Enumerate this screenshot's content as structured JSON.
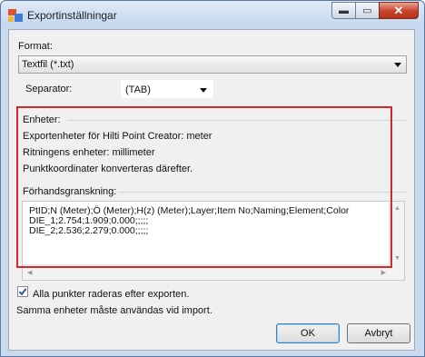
{
  "window": {
    "title": "Exportinställningar",
    "minimize_glyph": "▬",
    "maximize_glyph": "▭",
    "close_glyph": "✕"
  },
  "format": {
    "label": "Format:",
    "selected": "Textfil (*.txt)"
  },
  "separator": {
    "label": "Separator:",
    "selected": "(TAB)"
  },
  "units": {
    "heading": "Enheter:",
    "line1": "Exportenheter för Hilti Point Creator: meter",
    "line2": "Ritningens enheter: millimeter",
    "line3": "Punktkoordinater konverteras därefter."
  },
  "preview": {
    "heading": "Förhandsgranskning:",
    "lines": [
      "PtID;N (Meter);Ö (Meter);H(z) (Meter);Layer;Item No;Naming;Element;Color",
      "DIE_1;2.754;1.909;0.000;;;;;",
      "DIE_2;2.536;2.279;0.000;;;;;"
    ]
  },
  "checkbox": {
    "label": "Alla punkter raderas efter exporten.",
    "checked": true
  },
  "note": "Samma enheter måste användas vid import.",
  "buttons": {
    "ok": "OK",
    "cancel": "Avbryt"
  },
  "icons": {
    "app": "app-icon",
    "check": "checkmark-icon"
  },
  "colors": {
    "highlight": "#d8262a",
    "title_bg": "#c9daef",
    "close_button": "#c8412a"
  }
}
